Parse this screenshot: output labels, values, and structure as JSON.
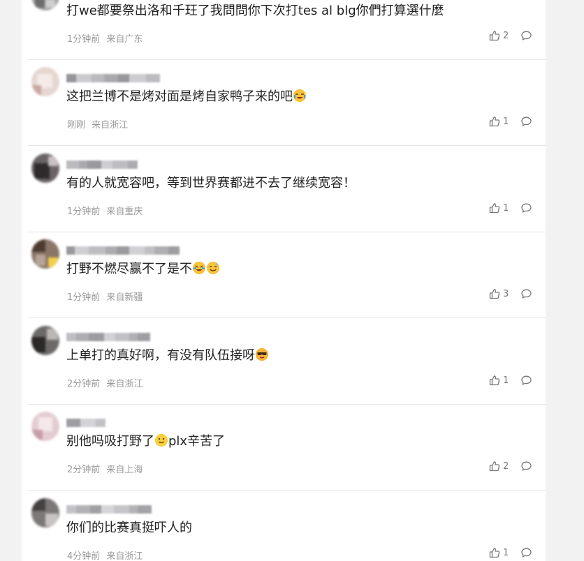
{
  "colors": {
    "page_bg": "#f2f2f2",
    "card_bg": "#ffffff",
    "text": "#222222",
    "meta": "#999999",
    "icon": "#777777"
  },
  "comments": [
    {
      "text": "打we都要祭出洛和千玨了我問問你下次打tes al blg你們打算選什麼",
      "time": "1分钟前",
      "location": "来自广东",
      "likes": "2",
      "emojis": [],
      "avatar": [
        "#8a8a8a",
        "#b7b7b7",
        "#5a5a5a"
      ]
    },
    {
      "text": "这把兰博不是烤对面是烤自家鸭子来的吧",
      "time": "刚刚",
      "location": "来自浙江",
      "likes": "1",
      "emojis": [
        "crying-laughing-emoji"
      ],
      "avatar": [
        "#d9c4be",
        "#efe3df",
        "#c9a9a1"
      ]
    },
    {
      "text": "有的人就宽容吧，等到世界赛都进不去了继续宽容！",
      "time": "1分钟前",
      "location": "来自重庆",
      "likes": "1",
      "emojis": [],
      "avatar": [
        "#3d3a3b",
        "#8b8486",
        "#c8c0c2"
      ]
    },
    {
      "text": "打野不燃尽赢不了是不",
      "time": "1分钟前",
      "location": "来自新疆",
      "likes": "3",
      "emojis": [
        "laughing-tears-emoji",
        "sweat-smile-emoji"
      ],
      "avatar": [
        "#5d4a3e",
        "#a48f82",
        "#f3cf4a"
      ]
    },
    {
      "text": "上单打的真好啊，有没有队伍接呀",
      "time": "2分钟前",
      "location": "来自浙江",
      "likes": "1",
      "emojis": [
        "cool-emoji"
      ],
      "avatar": [
        "#2e2c2c",
        "#7d7878",
        "#b9b3b2"
      ]
    },
    {
      "text": "别他吗吸打野了",
      "text2": "plx辛苦了",
      "time": "2分钟前",
      "location": "来自上海",
      "likes": "2",
      "emojis": [
        "smile-emoji"
      ],
      "avatar": [
        "#d7b9c0",
        "#f0dde1",
        "#c8a3ab"
      ]
    },
    {
      "text": "你们的比赛真挺吓人的",
      "time": "4分钟前",
      "location": "来自浙江",
      "likes": "1",
      "emojis": [],
      "avatar": [
        "#555252",
        "#8e8a88",
        "#c4c0bf"
      ]
    }
  ]
}
